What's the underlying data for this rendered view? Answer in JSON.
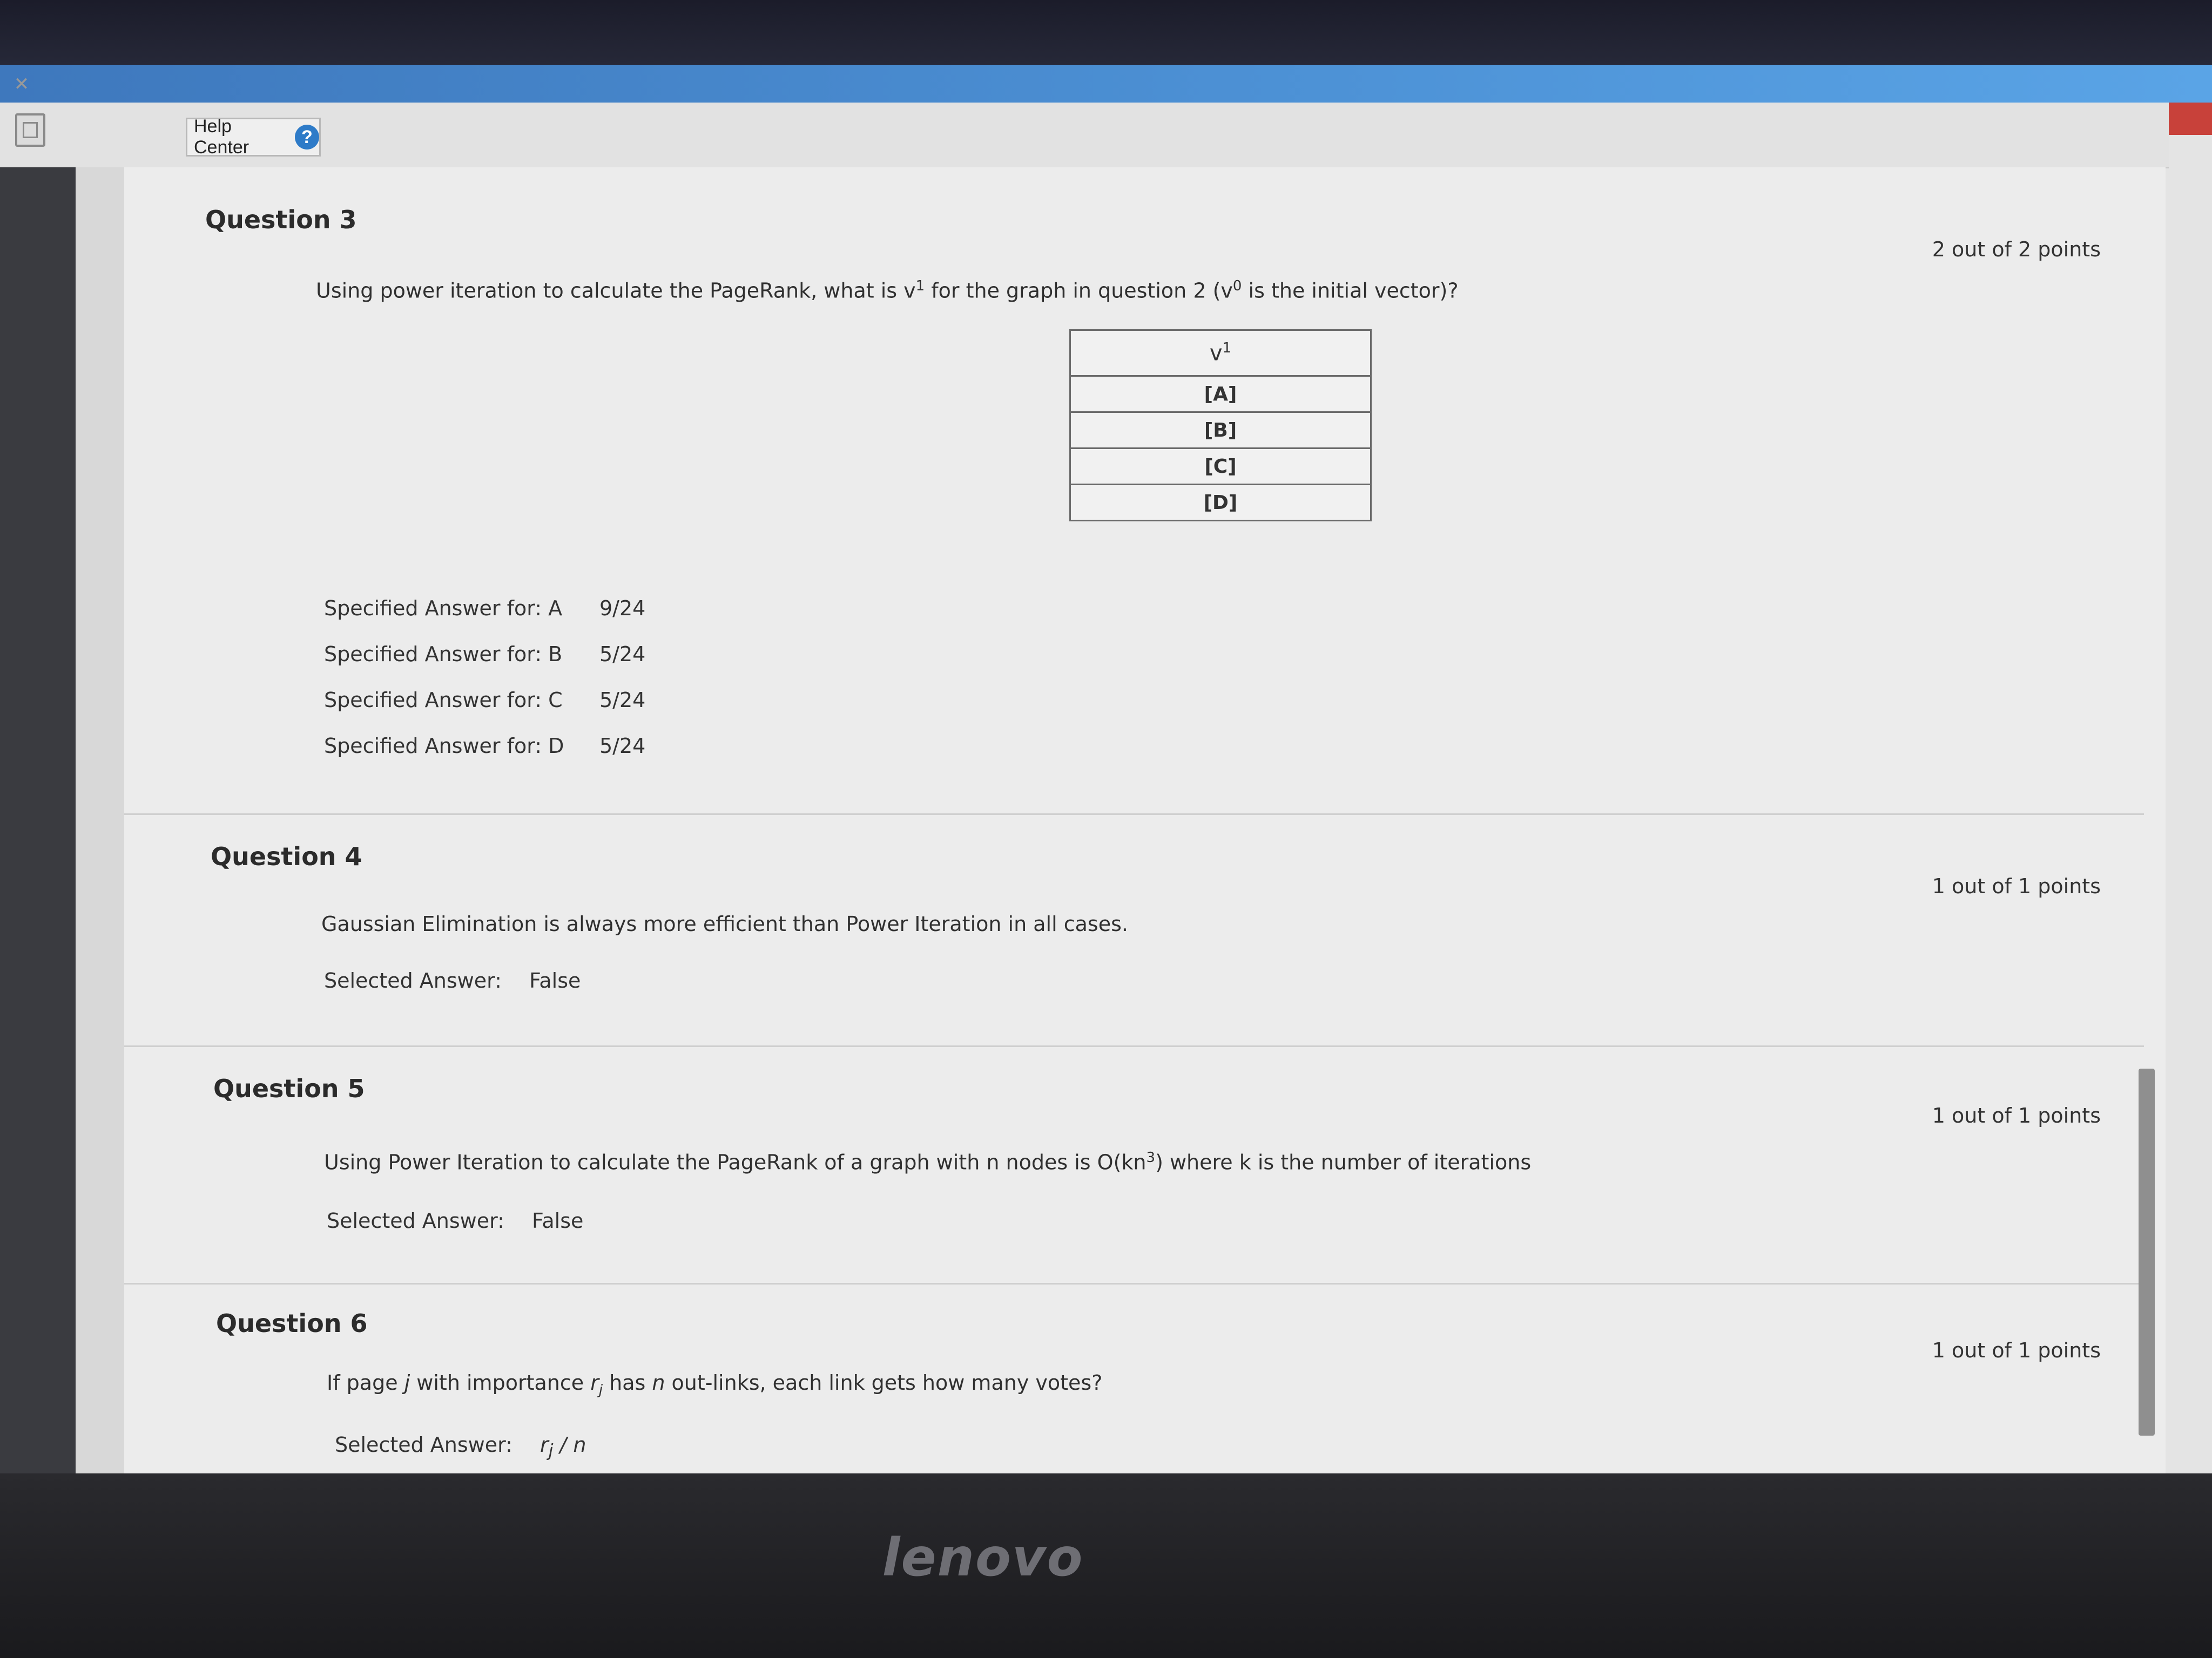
{
  "toolbar": {
    "help_center_label": "Help Center",
    "help_icon_glyph": "?"
  },
  "questions": [
    {
      "title": "Question 3",
      "points": "2 out of 2 points",
      "text_part1": "Using power iteration to calculate the PageRank, what is v",
      "text_sup1": "1",
      "text_part2": " for the graph in question 2 (v",
      "text_sup2": "0",
      "text_part3": " is the initial vector)?",
      "table": {
        "header_base": "v",
        "header_sup": "1",
        "rows": [
          "[A]",
          "[B]",
          "[C]",
          "[D]"
        ]
      },
      "answers": [
        {
          "label": "Specified Answer for: A",
          "value": "9/24"
        },
        {
          "label": "Specified Answer for: B",
          "value": "5/24"
        },
        {
          "label": "Specified Answer for: C",
          "value": "5/24"
        },
        {
          "label": "Specified Answer for: D",
          "value": "5/24"
        }
      ]
    },
    {
      "title": "Question 4",
      "points": "1 out of 1 points",
      "text": "Gaussian Elimination is always more efficient than Power Iteration in all cases.",
      "answer_label": "Selected Answer:",
      "answer_value": "False"
    },
    {
      "title": "Question 5",
      "points": "1 out of 1 points",
      "text_part1": "Using Power Iteration to calculate the PageRank of a graph with n nodes is O(kn",
      "text_sup": "3",
      "text_part2": ") where k is the number of iterations",
      "answer_label": "Selected Answer:",
      "answer_value": "False"
    },
    {
      "title": "Question 6",
      "points": "1 out of 1 points",
      "text_part1": "If page ",
      "text_j": "j",
      "text_part2": " with importance ",
      "text_r": "r",
      "text_rsub": "j",
      "text_part3": " has ",
      "text_n": "n",
      "text_part4": " out-links, each link gets how many votes?",
      "answer_label": "Selected Answer:",
      "answer_r": "r",
      "answer_sub": "j",
      "answer_rest": " / n"
    }
  ],
  "brand": "lenovo",
  "colors": {
    "accent_blue": "#4d92d6",
    "help_icon": "#2e7bc8"
  }
}
